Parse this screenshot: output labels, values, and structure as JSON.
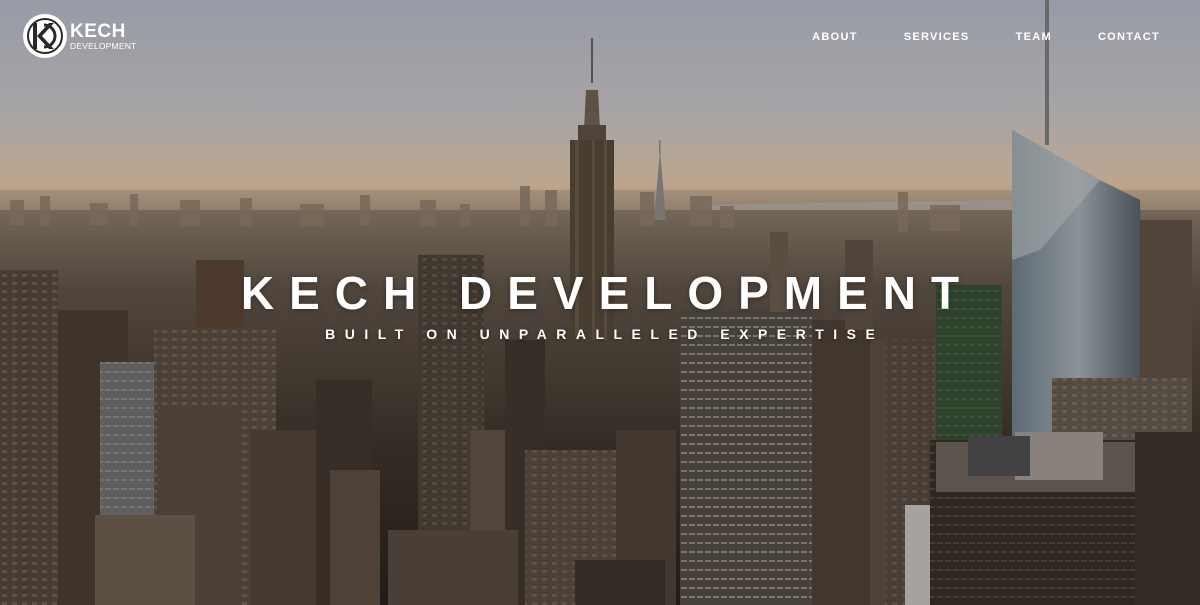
{
  "brand": {
    "name_line1": "KECH",
    "name_line2": "DEVELOPMENT",
    "logo_icon": "kd-monogram-logo"
  },
  "nav": {
    "items": [
      {
        "label": "ABOUT"
      },
      {
        "label": "SERVICES"
      },
      {
        "label": "TEAM"
      },
      {
        "label": "CONTACT"
      }
    ]
  },
  "hero": {
    "title": "KECH DEVELOPMENT",
    "subtitle": "BUILT ON UNPARALLELED EXPERTISE",
    "background": "city-skyline-photo"
  },
  "colors": {
    "text": "#ffffff",
    "sky_top": "#b8bfcc",
    "sky_horizon": "#e6c7a6",
    "city_dark": "#2a2622"
  }
}
